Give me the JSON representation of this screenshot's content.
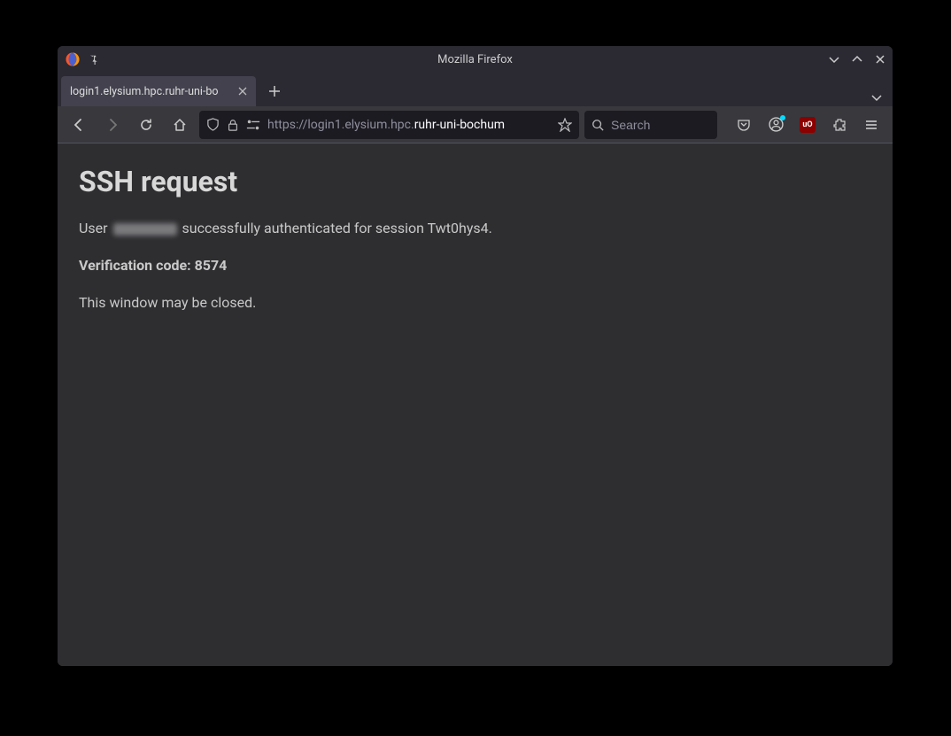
{
  "window": {
    "title": "Mozilla Firefox"
  },
  "tab": {
    "label": "login1.elysium.hpc.ruhr-uni-bo"
  },
  "urlbar": {
    "prefix": "https://login1.elysium.hpc.",
    "domain": "ruhr-uni-bochum"
  },
  "searchbar": {
    "placeholder": "Search"
  },
  "toolbar": {
    "ublock_label": "uO"
  },
  "page": {
    "heading": "SSH request",
    "p1_a": "User ",
    "p1_b": " successfully authenticated for session Twt0hys4.",
    "p2": "Verification code: 8574",
    "p3": "This window may be closed."
  }
}
